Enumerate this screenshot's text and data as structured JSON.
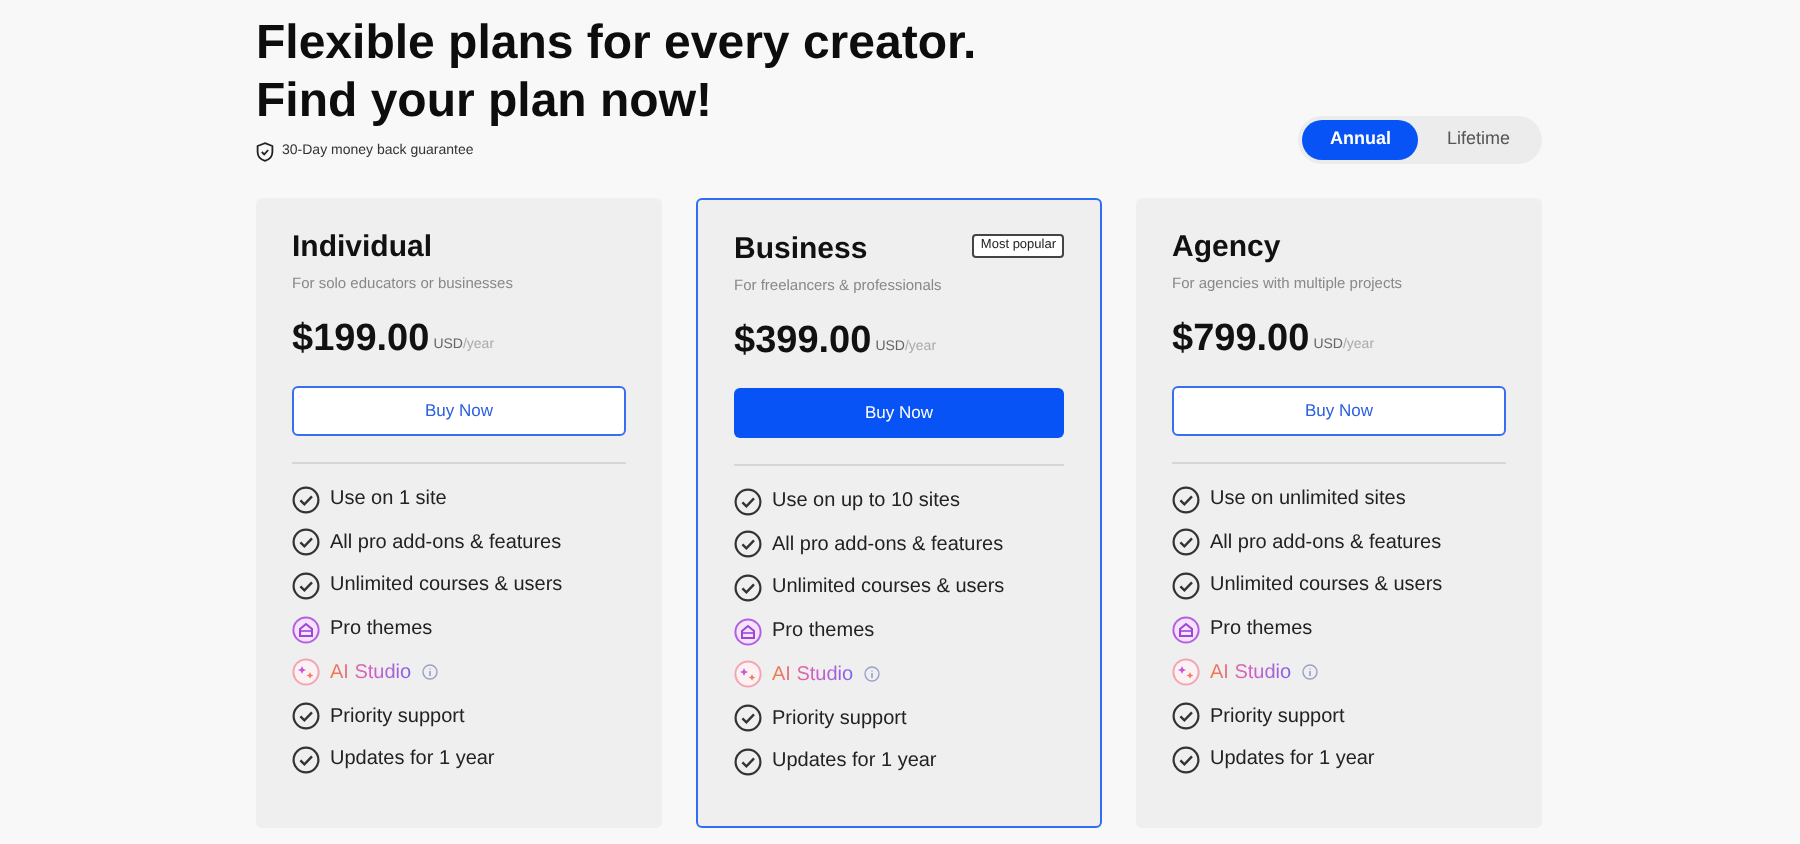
{
  "heading": {
    "lines": [
      "Flexible plans for every creator.",
      "Find your plan now!"
    ],
    "guarantee": "30-Day money back guarantee"
  },
  "billing_toggle": [
    {
      "label": "Annual",
      "selected": true
    },
    {
      "label": "Lifetime",
      "selected": false
    }
  ],
  "plans": [
    {
      "name": "Individual",
      "description": "For solo educators or businesses",
      "price": "$199.00",
      "currency": "USD",
      "period": "/year",
      "button": "Buy Now",
      "featured": false,
      "features": [
        {
          "kind": "check",
          "label": "Use on 1 site"
        },
        {
          "kind": "check",
          "label": "All pro add-ons & features"
        },
        {
          "kind": "check",
          "label": "Unlimited courses & users"
        },
        {
          "kind": "theme",
          "label": "Pro themes"
        },
        {
          "kind": "ai",
          "label": "AI Studio"
        },
        {
          "kind": "check",
          "label": "Priority support"
        },
        {
          "kind": "check",
          "label": "Updates for 1 year"
        }
      ]
    },
    {
      "name": "Business",
      "badge": "Most popular",
      "description": "For freelancers & professionals",
      "price": "$399.00",
      "currency": "USD",
      "period": "/year",
      "button": "Buy Now",
      "featured": true,
      "features": [
        {
          "kind": "check",
          "label": "Use on up to 10 sites"
        },
        {
          "kind": "check",
          "label": "All pro add-ons & features"
        },
        {
          "kind": "check",
          "label": "Unlimited courses & users"
        },
        {
          "kind": "theme",
          "label": "Pro themes"
        },
        {
          "kind": "ai",
          "label": "AI Studio"
        },
        {
          "kind": "check",
          "label": "Priority support"
        },
        {
          "kind": "check",
          "label": "Updates for 1 year"
        }
      ]
    },
    {
      "name": "Agency",
      "description": "For agencies with multiple projects",
      "price": "$799.00",
      "currency": "USD",
      "period": "/year",
      "button": "Buy Now",
      "featured": false,
      "features": [
        {
          "kind": "check",
          "label": "Use on unlimited sites"
        },
        {
          "kind": "check",
          "label": "All pro add-ons & features"
        },
        {
          "kind": "check",
          "label": "Unlimited courses & users"
        },
        {
          "kind": "theme",
          "label": "Pro themes"
        },
        {
          "kind": "ai",
          "label": "AI Studio"
        },
        {
          "kind": "check",
          "label": "Priority support"
        },
        {
          "kind": "check",
          "label": "Updates for 1 year"
        }
      ]
    }
  ]
}
